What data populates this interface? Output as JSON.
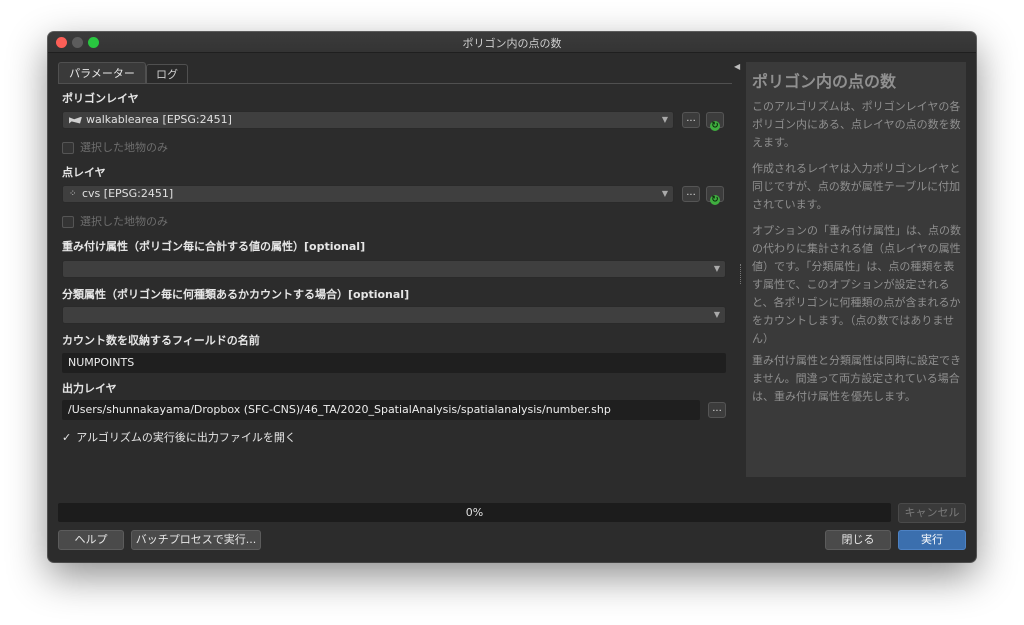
{
  "window": {
    "title": "ポリゴン内の点の数"
  },
  "tabs": [
    {
      "label": "パラメーター"
    },
    {
      "label": "ログ"
    }
  ],
  "params": {
    "polygon_layer": {
      "label": "ポリゴンレイヤ",
      "value": "walkablearea [EPSG:2451]",
      "icon": "polygon-layer-icon"
    },
    "polygon_selected_only": "選択した地物のみ",
    "point_layer": {
      "label": "点レイヤ",
      "value": "cvs [EPSG:2451]",
      "icon": "point-layer-icon"
    },
    "point_selected_only": "選択した地物のみ",
    "weight_field": {
      "label": "重み付け属性（ポリゴン毎に合計する値の属性）[optional]",
      "value": ""
    },
    "class_field": {
      "label": "分類属性（ポリゴン毎に何種類あるかカウントする場合）[optional]",
      "value": ""
    },
    "count_field": {
      "label": "カウント数を収納するフィールドの名前",
      "value": "NUMPOINTS"
    },
    "output": {
      "label": "出力レイヤ",
      "value": "/Users/shunnakayama/Dropbox (SFC-CNS)/46_TA/2020_SpatialAnalysis/spatialanalysis/number.shp"
    },
    "open_output": {
      "label": "アルゴリズムの実行後に出力ファイルを開く",
      "checked": true
    },
    "browse_label": "..."
  },
  "help": {
    "title": "ポリゴン内の点の数",
    "p1": "このアルゴリズムは、ポリゴンレイヤの各ポリゴン内にある、点レイヤの点の数を数えます。",
    "p2": "作成されるレイヤは入力ポリゴンレイヤと同じですが、点の数が属性テーブルに付加されています。",
    "p3": "オプションの「重み付け属性」は、点の数の代わりに集計される値（点レイヤの属性値）です。「分類属性」は、点の種類を表す属性で、このオプションが設定されると、各ポリゴンに何種類の点が含まれるかをカウントします。（点の数ではありません）",
    "p4": "重み付け属性と分類属性は同時に設定できません。間違って両方設定されている場合は、重み付け属性を優先します。"
  },
  "progress": {
    "text": "0%",
    "value": 0
  },
  "buttons": {
    "cancel": "キャンセル",
    "help": "ヘルプ",
    "batch": "バッチプロセスで実行...",
    "close": "閉じる",
    "run": "実行"
  },
  "colors": {
    "accent": "#3b6fae",
    "refresh": "#3fae3f"
  }
}
